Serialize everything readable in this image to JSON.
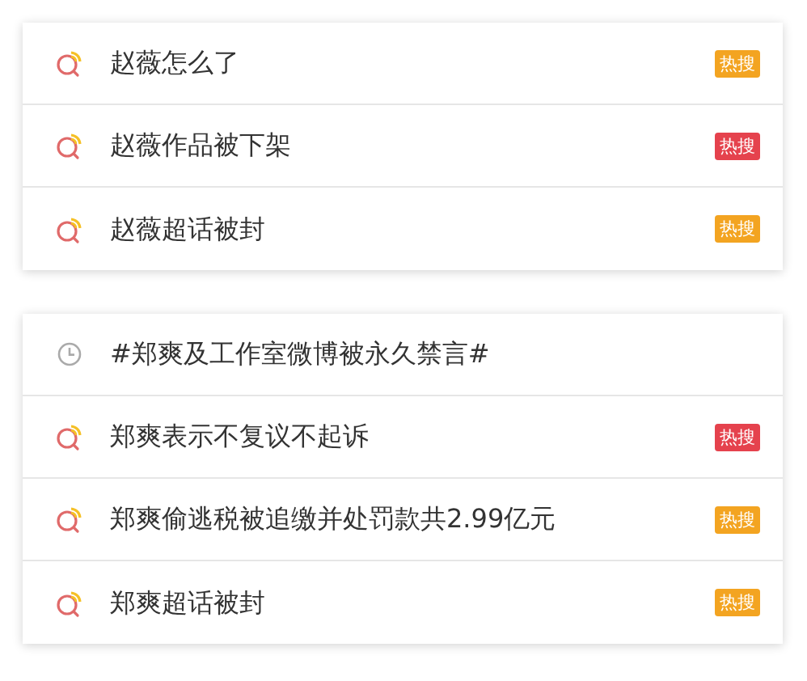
{
  "groups": [
    {
      "items": [
        {
          "kind": "search",
          "text": "赵薇怎么了",
          "badge": {
            "label": "热搜",
            "color": "#f3a421"
          }
        },
        {
          "kind": "search",
          "text": "赵薇作品被下架",
          "badge": {
            "label": "热搜",
            "color": "#e5424d"
          }
        },
        {
          "kind": "search",
          "text": "赵薇超话被封",
          "badge": {
            "label": "热搜",
            "color": "#f3a421"
          }
        }
      ]
    },
    {
      "items": [
        {
          "kind": "history",
          "text": "#郑爽及工作室微博被永久禁言#"
        },
        {
          "kind": "search",
          "text": "郑爽表示不复议不起诉",
          "badge": {
            "label": "热搜",
            "color": "#e5424d"
          }
        },
        {
          "kind": "search",
          "text": "郑爽偷逃税被追缴并处罚款共2.99亿元",
          "badge": {
            "label": "热搜",
            "color": "#f3a421"
          }
        },
        {
          "kind": "search",
          "text": "郑爽超话被封",
          "badge": {
            "label": "热搜",
            "color": "#f3a421"
          }
        }
      ]
    }
  ]
}
